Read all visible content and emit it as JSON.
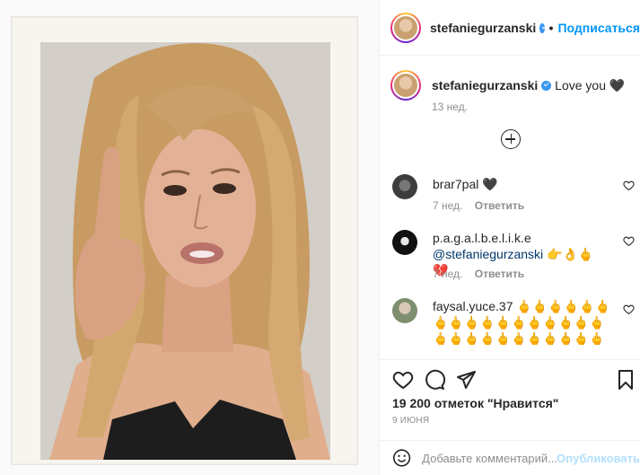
{
  "post": {
    "author": "stefaniegurzanski",
    "follow_label": "Подписаться",
    "caption_text": "Love you",
    "caption_time": "13 нед.",
    "likes": "19 200 отметок \"Нравится\"",
    "date": "9 ИЮНЯ"
  },
  "comments": [
    {
      "user": "brar7pal",
      "text": "🖤",
      "time": "7 нед.",
      "reply_label": "Ответить"
    },
    {
      "user": "p.a.g.a.l.b.e.l.i.k.e",
      "mention": "@stefaniegurzanski",
      "text": "👉👌🖕💔",
      "time": "7 нед.",
      "reply_label": "Ответить"
    },
    {
      "user": "faysal.yuce.37",
      "text": "🖕🖕🖕🖕🖕🖕🖕🖕🖕🖕🖕🖕🖕🖕🖕🖕🖕🖕🖕🖕🖕🖕🖕🖕🖕🖕🖕🖕🖕🖕🖕🖕🖕🖕🖕🖕🖕🖕🖕🖕"
    }
  ],
  "add_comment": {
    "placeholder": "Добавьте комментарий...",
    "publish_label": "Опубликовать"
  },
  "colors": {
    "accent": "#0095f6",
    "publish_disabled": "#b2dffc",
    "meta_text": "#8e8e8e"
  },
  "icons": [
    "plus-circle-icon",
    "heart-icon",
    "comment-icon",
    "share-icon",
    "bookmark-icon",
    "verified-icon"
  ]
}
